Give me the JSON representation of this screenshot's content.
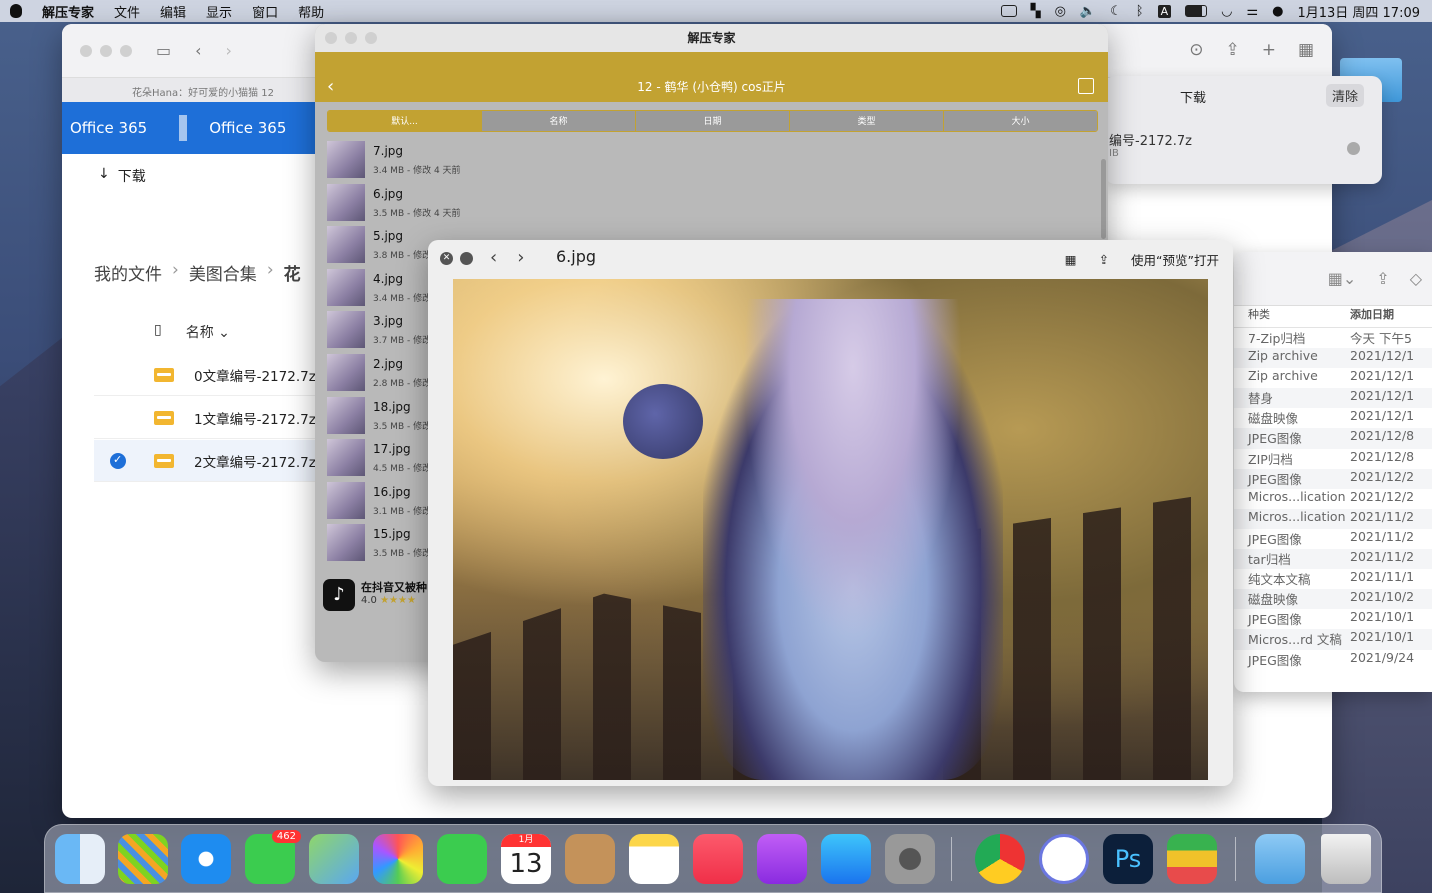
{
  "menubar": {
    "app": "解压专家",
    "items": [
      "文件",
      "编辑",
      "显示",
      "窗口",
      "帮助"
    ],
    "input_method": "A",
    "datetime": "1月13日 周四  17:09"
  },
  "safari": {
    "tab_title": "花朵Hana：好可爱的小猫猫 12",
    "brand_left": "Office 365",
    "brand_right": "Office 365",
    "download_label": "下载",
    "breadcrumb": [
      "我的文件",
      "美图合集",
      "花"
    ],
    "name_column": "名称",
    "files": [
      "0文章编号-2172.7z",
      "1文章编号-2172.7z",
      "2文章编号-2172.7z"
    ]
  },
  "downloads": {
    "title": "下载",
    "clear": "清除",
    "file_name": "编号-2172.7z",
    "file_size": "IB"
  },
  "finder": {
    "col_kind": "种类",
    "col_date": "添加日期",
    "rows": [
      {
        "kind": "7-Zip归档",
        "date": "今天 下午5"
      },
      {
        "kind": "Zip archive",
        "date": "2021/12/1"
      },
      {
        "kind": "Zip archive",
        "date": "2021/12/1"
      },
      {
        "kind": "替身",
        "date": "2021/12/1"
      },
      {
        "kind": "磁盘映像",
        "date": "2021/12/1"
      },
      {
        "kind": "JPEG图像",
        "date": "2021/12/8"
      },
      {
        "kind": "ZIP归档",
        "date": "2021/12/8"
      },
      {
        "kind": "JPEG图像",
        "date": "2021/12/2"
      },
      {
        "kind": "Micros...lication",
        "date": "2021/12/2"
      },
      {
        "kind": "Micros...lication",
        "date": "2021/11/2"
      },
      {
        "kind": "JPEG图像",
        "date": "2021/11/2"
      },
      {
        "kind": "tar归档",
        "date": "2021/11/2"
      },
      {
        "kind": "纯文本文稿",
        "date": "2021/11/1"
      },
      {
        "kind": "磁盘映像",
        "date": "2021/10/2"
      },
      {
        "kind": "JPEG图像",
        "date": "2021/10/1"
      },
      {
        "kind": "Micros...rd 文稿",
        "date": "2021/10/1"
      },
      {
        "kind": "JPEG图像",
        "date": "2021/9/24"
      }
    ]
  },
  "unarchiver": {
    "window_title": "解压专家",
    "archive_title": "12 - 鹤华 (小仓鸭) cos正片",
    "tabs": [
      "默认...",
      "名称",
      "日期",
      "类型",
      "大小"
    ],
    "items": [
      {
        "name": "7.jpg",
        "meta": "3.4 MB - 修改 4 天前"
      },
      {
        "name": "6.jpg",
        "meta": "3.5 MB - 修改 4 天前"
      },
      {
        "name": "5.jpg",
        "meta": "3.8 MB - 修改"
      },
      {
        "name": "4.jpg",
        "meta": "3.4 MB - 修改"
      },
      {
        "name": "3.jpg",
        "meta": "3.7 MB - 修改"
      },
      {
        "name": "2.jpg",
        "meta": "2.8 MB - 修改"
      },
      {
        "name": "18.jpg",
        "meta": "3.5 MB - 修改"
      },
      {
        "name": "17.jpg",
        "meta": "4.5 MB - 修改"
      },
      {
        "name": "16.jpg",
        "meta": "3.1 MB - 修改"
      },
      {
        "name": "15.jpg",
        "meta": "3.5 MB - 修改"
      }
    ],
    "ad_title": "在抖音又被种",
    "ad_rating": "4.0",
    "ad_stars": "★★★★"
  },
  "quicklook": {
    "title": "6.jpg",
    "open_with": "使用“预览”打开"
  },
  "dock": {
    "messages_badge": "462",
    "calendar_month": "1月",
    "calendar_day": "13"
  },
  "colors": {
    "office_blue": "#1e6fd8",
    "unarchiver_gold": "#c2a232"
  }
}
